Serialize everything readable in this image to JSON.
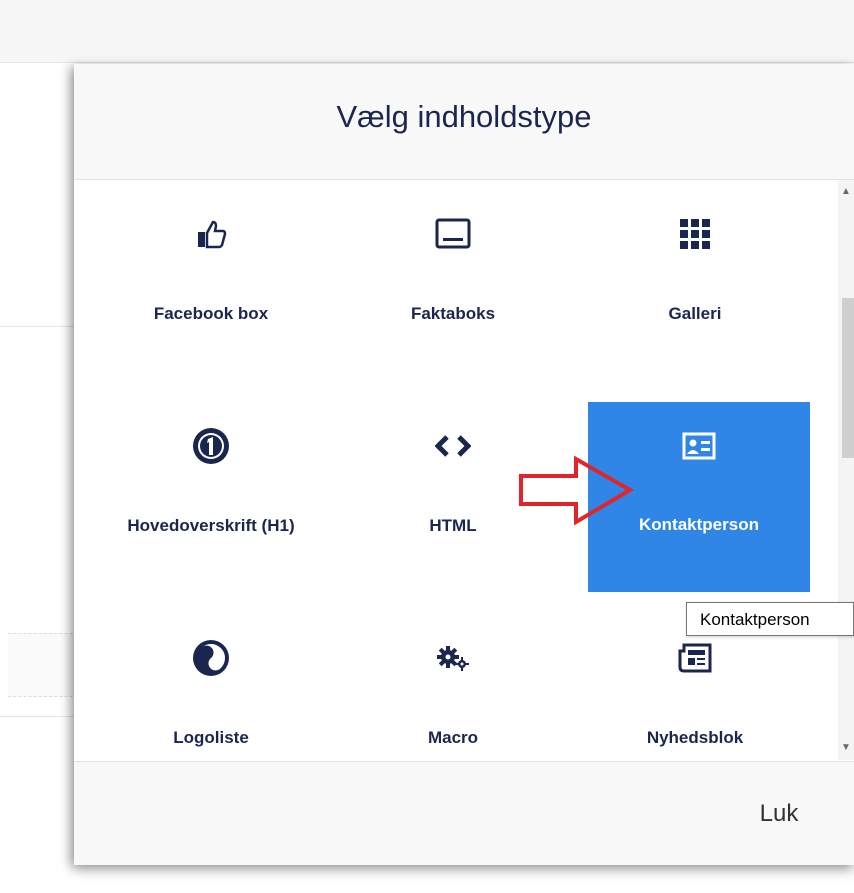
{
  "dialog": {
    "title": "Vælg indholdstype",
    "close_label": "Luk"
  },
  "tiles": [
    {
      "label": "Facebook box",
      "icon": "thumbs-up-icon"
    },
    {
      "label": "Faktaboks",
      "icon": "window-icon"
    },
    {
      "label": "Galleri",
      "icon": "grid-icon"
    },
    {
      "label": "Hovedoverskrift (H1)",
      "icon": "number-one-icon"
    },
    {
      "label": "HTML",
      "icon": "code-icon"
    },
    {
      "label": "Kontaktperson",
      "icon": "id-card-icon",
      "selected": true
    },
    {
      "label": "Logoliste",
      "icon": "yin-yang-icon"
    },
    {
      "label": "Macro",
      "icon": "gears-icon"
    },
    {
      "label": "Nyhedsblok",
      "icon": "newspaper-icon"
    }
  ],
  "tooltip": "Kontaktperson",
  "colors": {
    "selected": "#2f86e6",
    "text": "#1b264f",
    "annotation": "#e0252b"
  }
}
